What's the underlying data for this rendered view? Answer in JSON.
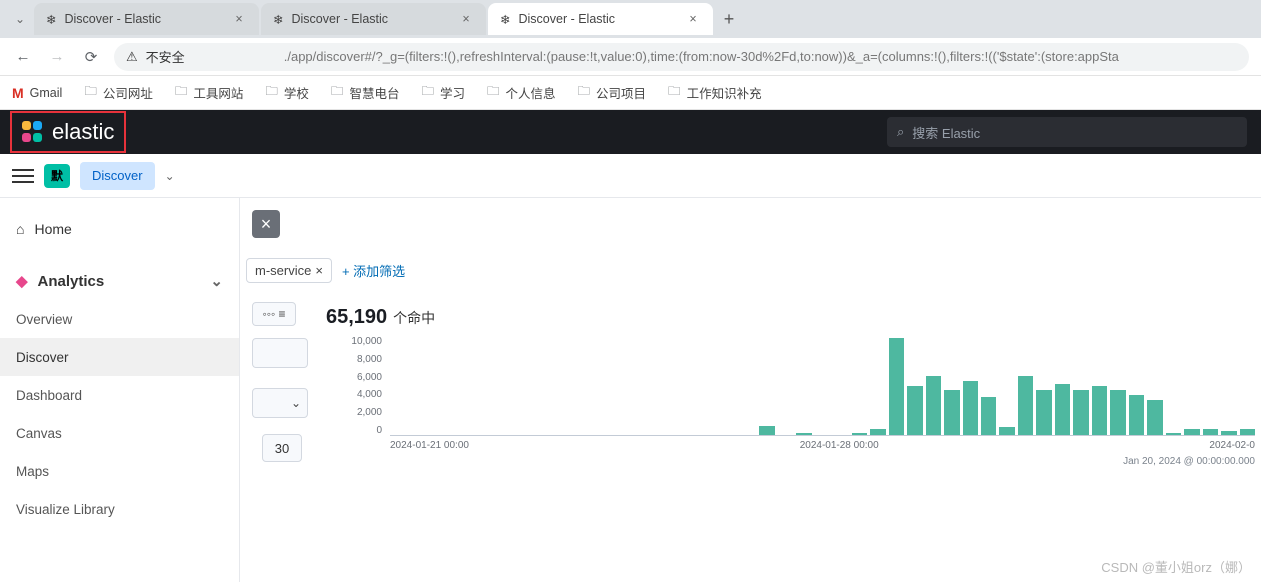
{
  "browser": {
    "tabs": [
      {
        "title": "Discover - Elastic",
        "active": false
      },
      {
        "title": "Discover - Elastic",
        "active": false
      },
      {
        "title": "Discover - Elastic",
        "active": true
      }
    ],
    "security_label": "不安全",
    "url_display": "./app/discover#/?_g=(filters:!(),refreshInterval:(pause:!t,value:0),time:(from:now-30d%2Fd,to:now))&_a=(columns:!(),filters:!(('$state':(store:appSta"
  },
  "bookmarks": {
    "gmail": "Gmail",
    "items": [
      "公司网址",
      "工具网站",
      "学校",
      "智慧电台",
      "学习",
      "个人信息",
      "公司项目",
      "工作知识补充"
    ]
  },
  "header": {
    "brand": "elastic",
    "search_placeholder": "搜索 Elastic"
  },
  "subheader": {
    "badge": "默",
    "page": "Discover"
  },
  "sidenav": {
    "home": "Home",
    "section": "Analytics",
    "items": [
      "Overview",
      "Discover",
      "Dashboard",
      "Canvas",
      "Maps",
      "Visualize Library"
    ],
    "selected": "Discover"
  },
  "filters": {
    "chip_text": "m-service",
    "add_label": "添加筛选"
  },
  "hits": {
    "count": "65,190",
    "label": "个命中"
  },
  "small_num": "30",
  "timestamp_note": "Jan 20, 2024 @ 00:00:00.000",
  "watermark": "CSDN @董小姐orz（娜）",
  "chart_data": {
    "type": "bar",
    "ylabel": "",
    "xlabel": "",
    "ylim": [
      0,
      10000
    ],
    "y_ticks": [
      "10,000",
      "8,000",
      "6,000",
      "4,000",
      "2,000",
      "0"
    ],
    "x_ticks": [
      "2024-01-21 00:00",
      "2024-01-28 00:00",
      "2024-02-0"
    ],
    "values": [
      0,
      0,
      0,
      0,
      0,
      0,
      0,
      0,
      0,
      0,
      0,
      0,
      0,
      0,
      0,
      0,
      0,
      0,
      0,
      0,
      900,
      0,
      200,
      0,
      0,
      200,
      650,
      9800,
      5000,
      6000,
      4500,
      5500,
      3800,
      800,
      6000,
      4500,
      5200,
      4500,
      5000,
      4500,
      4000,
      3500,
      200,
      600,
      600,
      400,
      600
    ]
  }
}
